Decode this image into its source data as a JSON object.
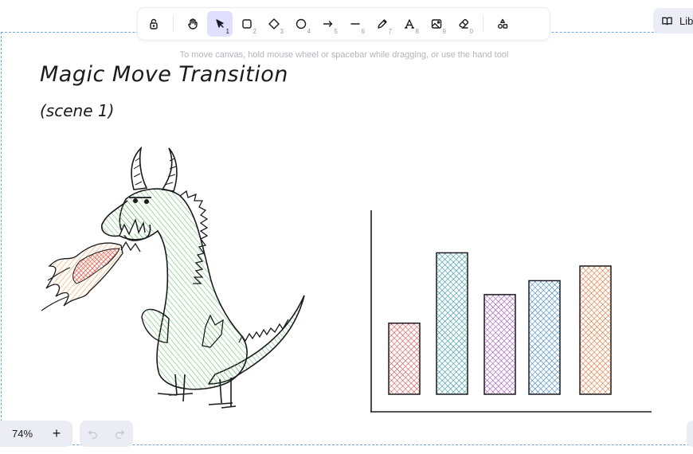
{
  "toolbar": {
    "tools": [
      {
        "name": "lock",
        "key": ""
      },
      {
        "name": "hand",
        "key": ""
      },
      {
        "name": "selection",
        "key": "1",
        "active": true
      },
      {
        "name": "rectangle",
        "key": "2"
      },
      {
        "name": "diamond",
        "key": "3"
      },
      {
        "name": "ellipse",
        "key": "4"
      },
      {
        "name": "arrow",
        "key": "5"
      },
      {
        "name": "line",
        "key": "6"
      },
      {
        "name": "draw",
        "key": "7"
      },
      {
        "name": "text",
        "key": "8"
      },
      {
        "name": "image",
        "key": "9"
      },
      {
        "name": "eraser",
        "key": "0"
      },
      {
        "name": "more-shapes",
        "key": ""
      }
    ]
  },
  "library": {
    "label": "Libr"
  },
  "hint": "To move canvas, hold mouse wheel or spacebar while dragging, or use the hand tool",
  "canvas": {
    "title": "Magic Move Transition",
    "subtitle": "(scene 1)"
  },
  "zoom": {
    "value": "74%",
    "plus": "+"
  },
  "colors": {
    "accent": "#e0dfff",
    "frame_border": "#6aa6e6",
    "dragon_fill": "#6cc26a",
    "flame_fill": "#e8590c",
    "bar_colors": [
      "#e03131",
      "#0c8599",
      "#9c36b5",
      "#1971c2",
      "#e8590c"
    ]
  },
  "chart_data": {
    "type": "bar",
    "categories": [
      "",
      "",
      "",
      "",
      ""
    ],
    "values": [
      97,
      193,
      136,
      155,
      175
    ],
    "title": "",
    "xlabel": "",
    "ylabel": "",
    "ylim": [
      0,
      250
    ],
    "grid": false
  }
}
